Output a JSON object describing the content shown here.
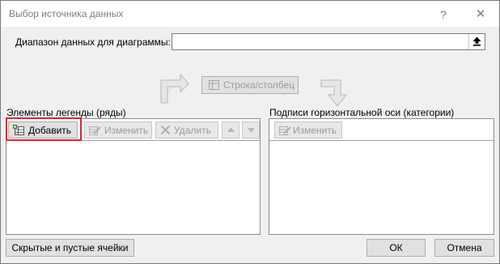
{
  "window": {
    "title": "Выбор источника данных",
    "help_glyph": "?",
    "close_glyph": "✕"
  },
  "range": {
    "label": "Диапазон данных для диаграммы:",
    "value": ""
  },
  "swap": {
    "label": "Строка/столбец"
  },
  "legend_section": {
    "label": "Элементы легенды (ряды)",
    "add_label": "Добавить",
    "edit_label": "Изменить",
    "remove_label": "Удалить",
    "items": []
  },
  "category_section": {
    "label": "Подписи горизонтальной оси (категории)",
    "edit_label": "Изменить",
    "items": []
  },
  "footer": {
    "hidden_cells_label": "Скрытые и пустые ячейки",
    "ok_label": "ОК",
    "cancel_label": "Отмена"
  },
  "colors": {
    "highlight": "#e0242c",
    "disabled_text": "#9a9a9a",
    "dialog_bg": "#f0f0f0"
  }
}
